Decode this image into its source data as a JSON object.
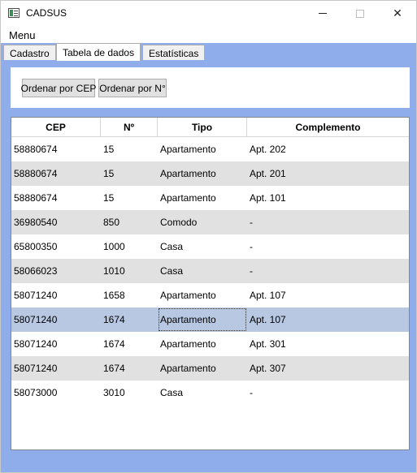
{
  "window": {
    "title": "CADSUS",
    "minimize_symbol": "",
    "close_symbol": "✕"
  },
  "menu": {
    "label": "Menu"
  },
  "tabs": [
    {
      "label": "Cadastro"
    },
    {
      "label": "Tabela de dados"
    },
    {
      "label": "Estatísticas"
    }
  ],
  "active_tab": "Tabela de dados",
  "toolbar": {
    "sort_cep_label": "Ordenar por CEP",
    "sort_num_label": "Ordenar por N°"
  },
  "colors": {
    "background_accent": "#8fadea",
    "row_alternate": "#e1e1e1",
    "row_selected": "#b8c8e3"
  },
  "table": {
    "columns": [
      "CEP",
      "Nº",
      "Tipo",
      "Complemento"
    ],
    "selected_row_index": 7,
    "rows": [
      {
        "cep": "58880674",
        "num": "15",
        "tipo": "Apartamento",
        "complemento": "Apt. 202"
      },
      {
        "cep": "58880674",
        "num": "15",
        "tipo": "Apartamento",
        "complemento": "Apt. 201"
      },
      {
        "cep": "58880674",
        "num": "15",
        "tipo": "Apartamento",
        "complemento": "Apt. 101"
      },
      {
        "cep": "36980540",
        "num": "850",
        "tipo": "Comodo",
        "complemento": "-"
      },
      {
        "cep": "65800350",
        "num": "1000",
        "tipo": "Casa",
        "complemento": "-"
      },
      {
        "cep": "58066023",
        "num": "1010",
        "tipo": "Casa",
        "complemento": "-"
      },
      {
        "cep": "58071240",
        "num": "1658",
        "tipo": "Apartamento",
        "complemento": "Apt. 107"
      },
      {
        "cep": "58071240",
        "num": "1674",
        "tipo": "Apartamento",
        "complemento": "Apt. 107"
      },
      {
        "cep": "58071240",
        "num": "1674",
        "tipo": "Apartamento",
        "complemento": "Apt. 301"
      },
      {
        "cep": "58071240",
        "num": "1674",
        "tipo": "Apartamento",
        "complemento": "Apt. 307"
      },
      {
        "cep": "58073000",
        "num": "3010",
        "tipo": "Casa",
        "complemento": "-"
      }
    ]
  }
}
